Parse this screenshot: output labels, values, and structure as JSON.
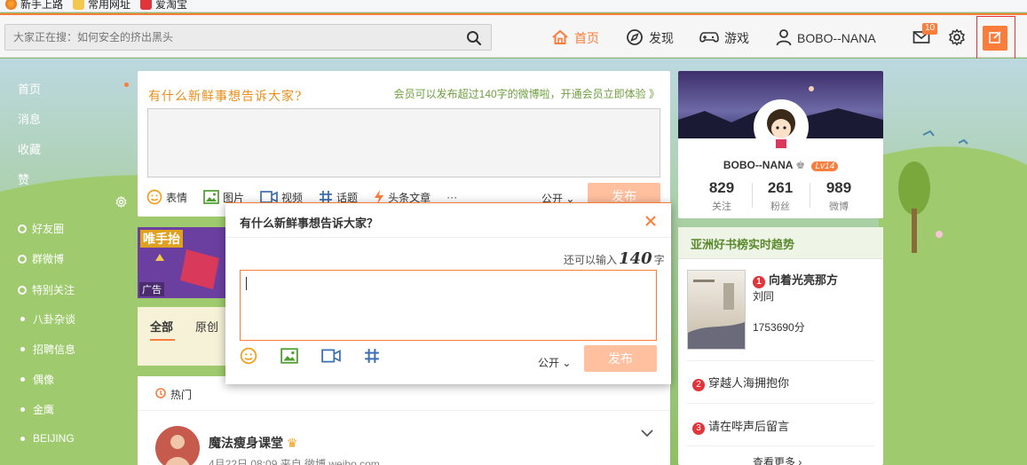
{
  "browser": {
    "bookmarks": [
      {
        "label": "新手上路"
      },
      {
        "label": "常用网址"
      },
      {
        "label": "爱淘宝"
      }
    ]
  },
  "topnav": {
    "search_placeholder": "大家正在搜：如何安全的挤出黑头",
    "links": [
      {
        "label": "首页",
        "icon": "home-icon"
      },
      {
        "label": "发现",
        "icon": "compass-icon"
      },
      {
        "label": "游戏",
        "icon": "gamepad-icon"
      },
      {
        "label": "BOBO--NANA",
        "icon": "user-icon"
      }
    ],
    "message_count": "10",
    "accent": "#fa7d3c"
  },
  "leftnav": {
    "main": [
      "首页",
      "消息",
      "收藏",
      "赞"
    ],
    "groups": [
      {
        "label": "好友圈",
        "icon": "ring"
      },
      {
        "label": "群微博",
        "icon": "ring"
      },
      {
        "label": "特别关注",
        "icon": "ring"
      },
      {
        "label": "八卦杂谈",
        "icon": "dot"
      },
      {
        "label": "招聘信息",
        "icon": "dot"
      },
      {
        "label": "偶像",
        "icon": "dot"
      },
      {
        "label": "金鹰",
        "icon": "dot"
      },
      {
        "label": "BEIJING",
        "icon": "dot"
      }
    ]
  },
  "publisher": {
    "title": "有什么新鲜事想告诉大家?",
    "tip": "会员可以发布超过140字的微博啦，开通会员立即体验 》",
    "tools": [
      "表情",
      "图片",
      "视频",
      "话题",
      "头条文章",
      "···"
    ],
    "visibility": "公开",
    "submit": "发布"
  },
  "ad": {
    "logo": "唯手抬",
    "label": "广告"
  },
  "feed": {
    "tabs": [
      "全部",
      "原创"
    ],
    "hot_label": "热门",
    "post": {
      "author": "魔法瘦身课堂",
      "meta": "4月22日 08:09 来自 微博 weibo.com"
    }
  },
  "profile": {
    "name": "BOBO--NANA",
    "level": "Lv14",
    "stats": [
      {
        "value": "829",
        "label": "关注"
      },
      {
        "value": "261",
        "label": "粉丝"
      },
      {
        "value": "989",
        "label": "微博"
      }
    ]
  },
  "trending": {
    "title": "亚洲好书榜实时趋势",
    "items": [
      {
        "rank": "1",
        "title": "向着光亮那方",
        "author": "刘同",
        "score": "1753690分"
      },
      {
        "rank": "2",
        "title": "穿越人海拥抱你"
      },
      {
        "rank": "3",
        "title": "请在哔声后留言"
      }
    ],
    "more": "查看更多 ›"
  },
  "modal": {
    "title": "有什么新鲜事想告诉大家？",
    "counter_prefix": "还可以输入",
    "counter_num": "140",
    "counter_suffix": "字",
    "visibility": "公开",
    "submit": "发布"
  }
}
